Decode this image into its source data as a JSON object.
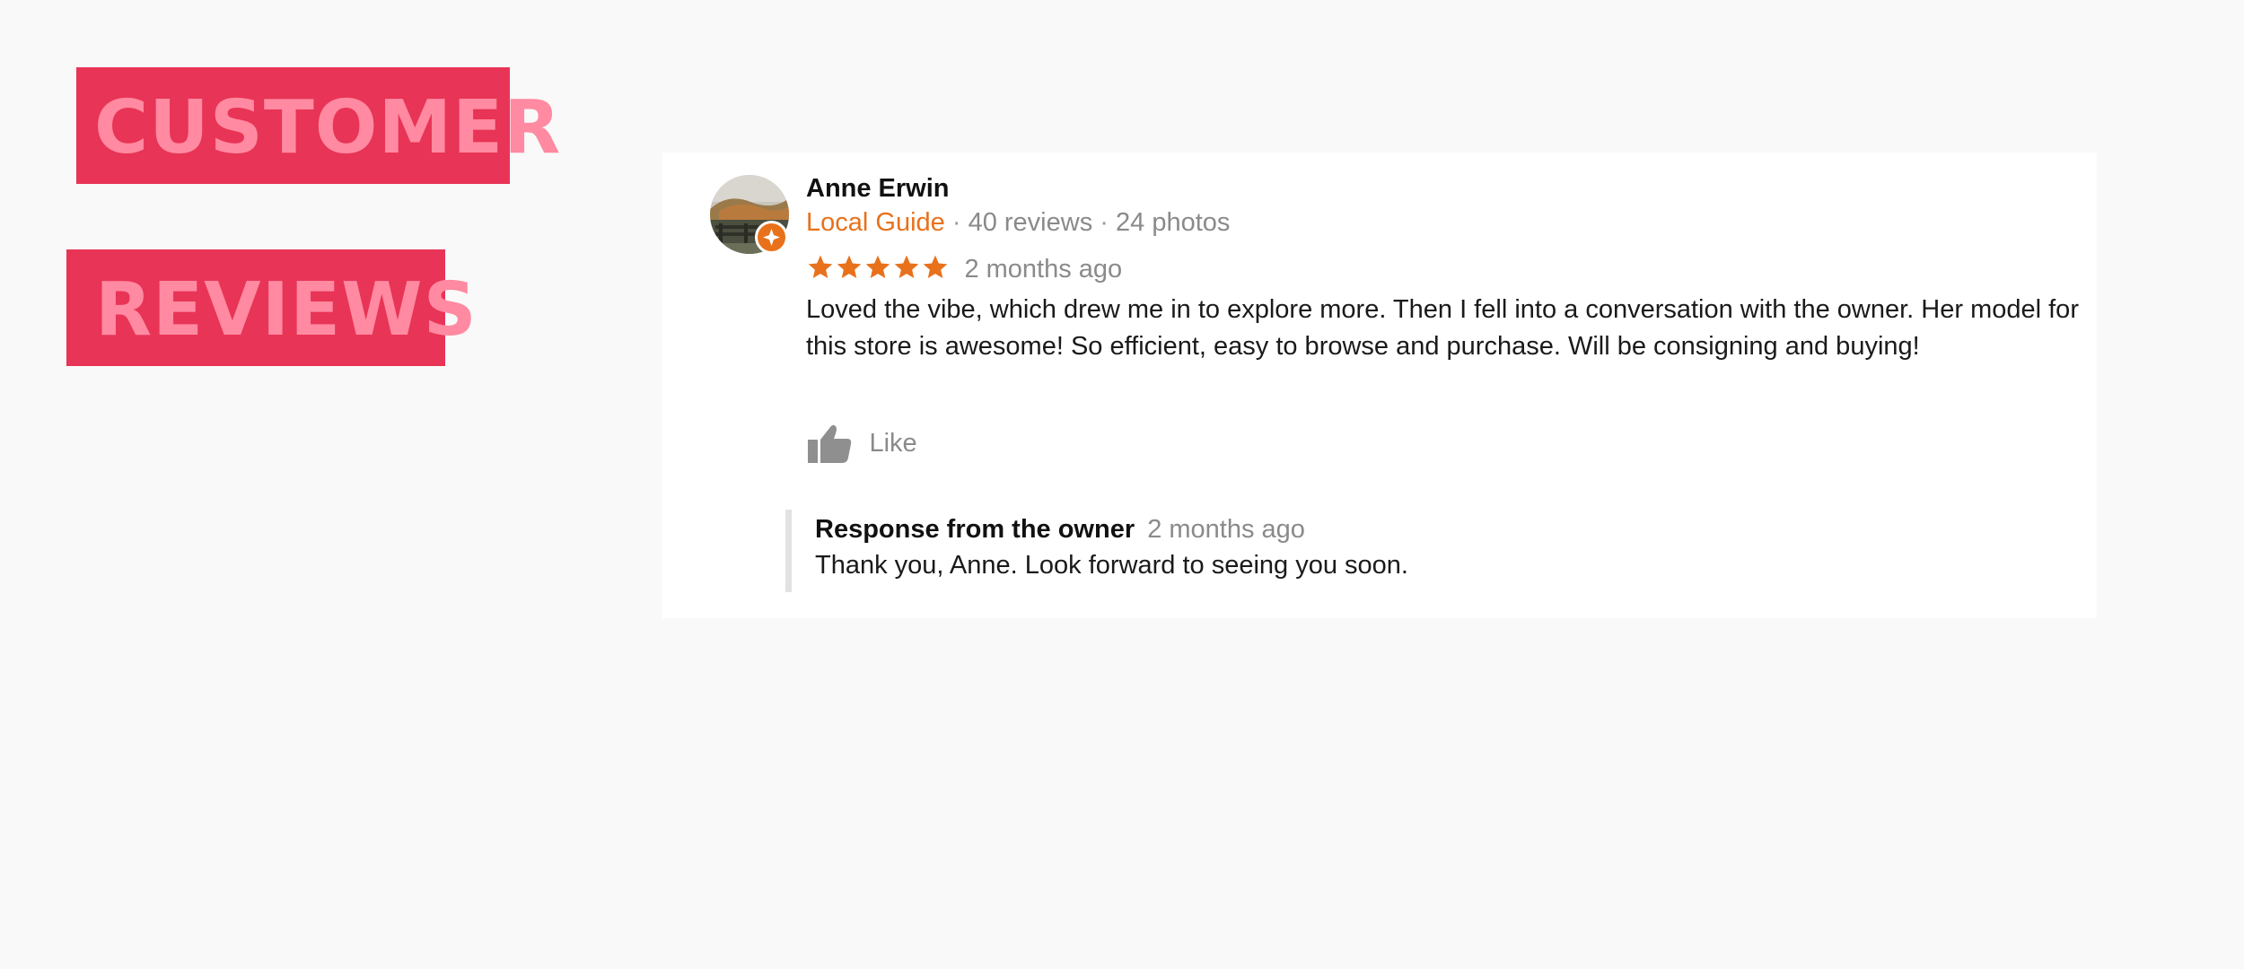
{
  "banners": {
    "customer": "CUSTOMER",
    "reviews": "REVIEWS"
  },
  "review": {
    "reviewer_name": "Anne Erwin",
    "badge": "Local Guide",
    "separator": "·",
    "review_count": "40 reviews",
    "photo_count": "24 photos",
    "rating_stars": 5,
    "time_ago": "2 months ago",
    "text": "Loved the vibe, which drew me in to explore more. Then I fell into a conversation with the owner. Her model for this store is awesome! So efficient, easy to browse and purchase. Will be consigning and buying!",
    "like_label": "Like",
    "owner_response": {
      "title": "Response from the owner",
      "time_ago": "2 months ago",
      "text": "Thank you, Anne. Look forward to seeing you soon."
    }
  },
  "icons": {
    "star": "star-icon",
    "like": "thumbs-up-icon",
    "avatar_badge": "local-guide-badge-icon"
  },
  "colors": {
    "banner_bg": "#e83456",
    "banner_text": "#ff8aa1",
    "accent_orange": "#e8711c",
    "muted_text": "#8a8a8a",
    "page_bg": "#f9f9f9",
    "card_bg": "#ffffff"
  }
}
